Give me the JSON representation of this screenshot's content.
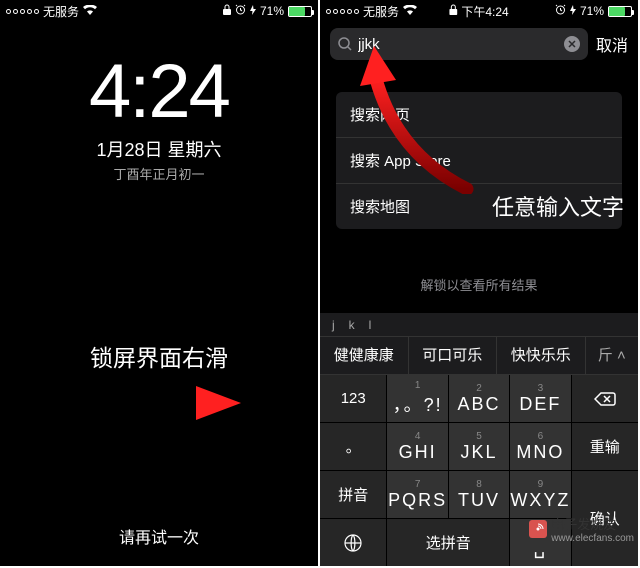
{
  "left": {
    "status": {
      "carrier": "无服务",
      "battery_pct": "71%",
      "battery_fill_pct": 71
    },
    "clock": {
      "time": "4:24",
      "date": "1月28日 星期六",
      "lunar": "丁酉年正月初一"
    },
    "message": "锁屏界面右滑",
    "retry": "请再试一次"
  },
  "right": {
    "status": {
      "carrier": "无服务",
      "time_label": "下午4:24",
      "battery_pct": "71%",
      "battery_fill_pct": 71
    },
    "search": {
      "value": "jjkk",
      "cancel": "取消"
    },
    "suggestions": [
      "搜索网页",
      "搜索 App Store",
      "搜索地图"
    ],
    "unlock_hint": "解锁以查看所有结果",
    "annotation": "任意输入文字",
    "keyboard": {
      "candidates": [
        "j",
        "k",
        "l"
      ],
      "phrases": [
        "健健康康",
        "可口可乐",
        "快快乐乐",
        "斤"
      ],
      "rows": [
        [
          {
            "main": "123",
            "dark": true
          },
          {
            "num": "1",
            "letters": "，。?!"
          },
          {
            "num": "2",
            "letters": "ABC"
          },
          {
            "num": "3",
            "letters": "DEF"
          },
          {
            "icon": "backspace",
            "dark": true
          }
        ],
        [
          {
            "main": "。",
            "dark": true
          },
          {
            "num": "4",
            "letters": "GHI"
          },
          {
            "num": "5",
            "letters": "JKL"
          },
          {
            "num": "6",
            "letters": "MNO"
          },
          {
            "main": "重输",
            "dark": true
          }
        ],
        [
          {
            "main": "拼音",
            "dark": true
          },
          {
            "num": "7",
            "letters": "PQRS"
          },
          {
            "num": "8",
            "letters": "TUV"
          },
          {
            "num": "9",
            "letters": "WXYZ"
          },
          {
            "main": "确认",
            "dark": true,
            "rowspan": true
          }
        ]
      ],
      "bottom": {
        "globe": true,
        "select_pinyin": "选拼音",
        "zero": {
          "num": "0",
          "letters": "␣"
        }
      }
    }
  },
  "watermark": {
    "text": "电子发烧友",
    "url": "www.elecfans.com"
  }
}
